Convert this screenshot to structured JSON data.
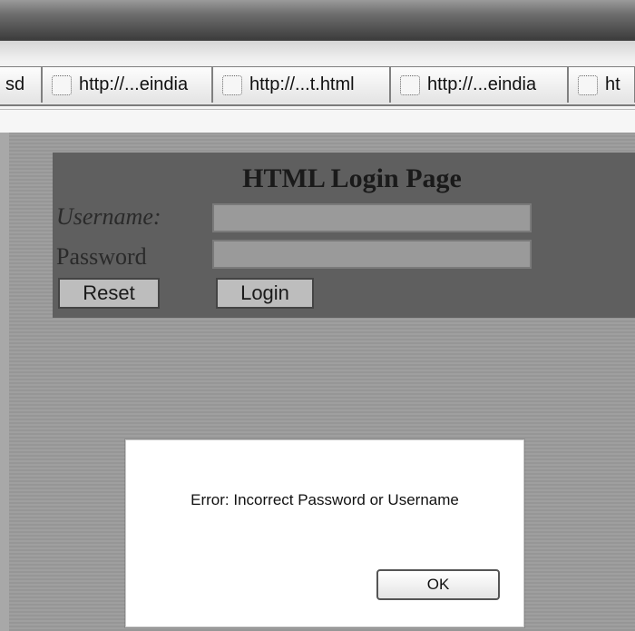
{
  "browser": {
    "tabs": [
      {
        "label": "sd",
        "partial": true
      },
      {
        "label": "http://...eindia"
      },
      {
        "label": "http://...t.html"
      },
      {
        "label": "http://...eindia"
      },
      {
        "label": "ht",
        "partial": true
      }
    ]
  },
  "login_page": {
    "title": "HTML Login Page",
    "username_label": "Username:",
    "password_label": "Password",
    "reset_label": "Reset",
    "login_label": "Login"
  },
  "dialog": {
    "message": "Error: Incorrect Password or Username",
    "ok_label": "OK"
  }
}
